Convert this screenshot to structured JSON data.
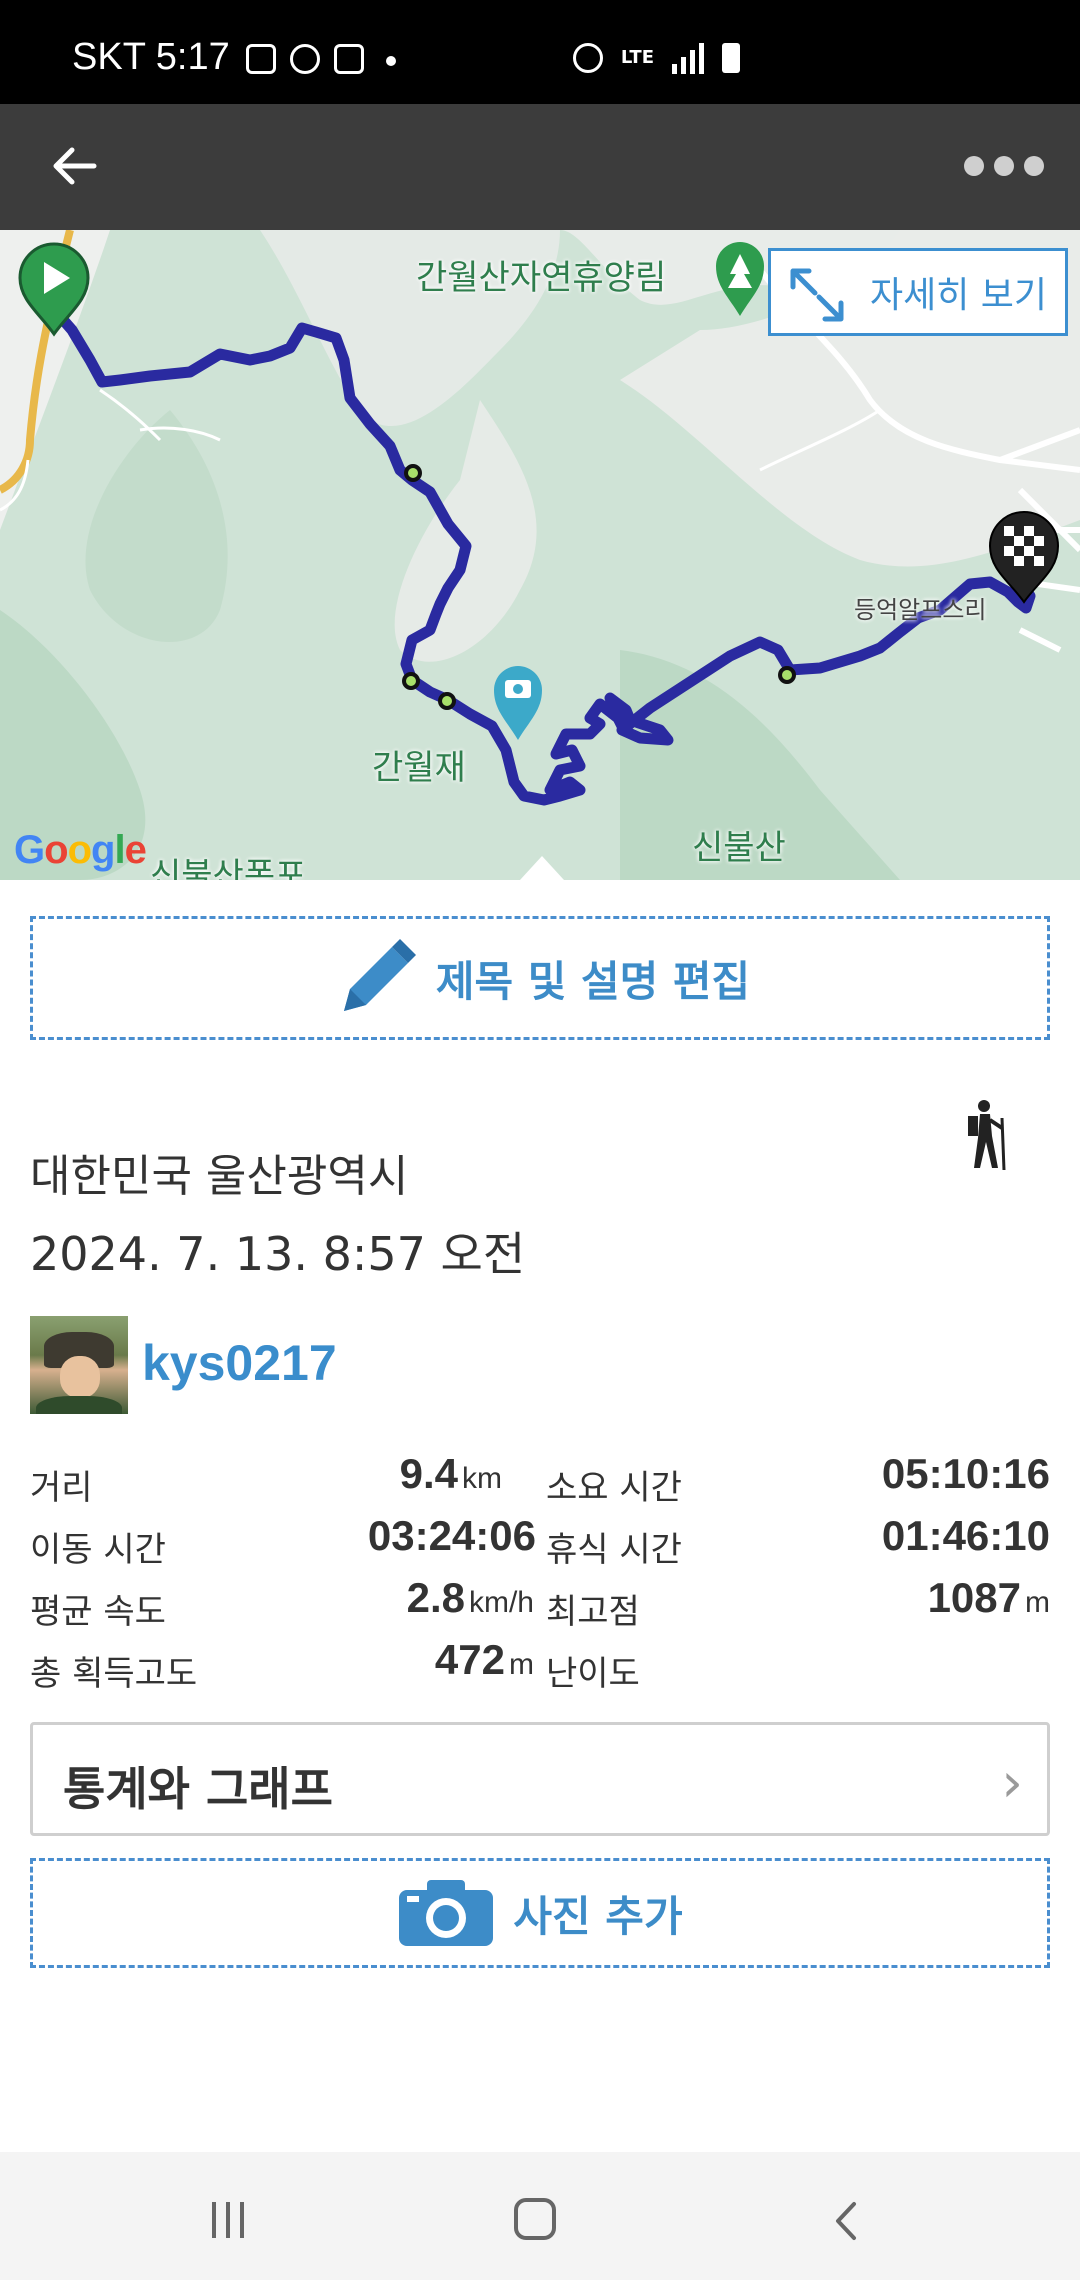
{
  "status_bar": {
    "carrier_time": "SKT 5:17",
    "network": "LTE"
  },
  "app_bar": {
    "back_icon": "arrow-left-icon",
    "more_icon": "more-dots-icon"
  },
  "map": {
    "expand_label": "자세히 보기",
    "labels": {
      "forest": "간월산자연휴양림",
      "pass": "간월재",
      "village": "등억알프스리",
      "mountain": "신불산",
      "bottom_left": "신불산폭포"
    },
    "attribution": "Google"
  },
  "edit_button": {
    "label": "제목 및 설명 편집"
  },
  "activity": {
    "location": "대한민국 울산광역시",
    "datetime": "2024. 7. 13. 8:57 오전",
    "type_icon": "hiking-icon"
  },
  "user": {
    "name": "kys0217"
  },
  "stats": {
    "distance": {
      "label": "거리",
      "value": "9.4",
      "unit": "km"
    },
    "total_time": {
      "label": "소요 시간",
      "value": "05:10:16"
    },
    "moving_time": {
      "label": "이동 시간",
      "value": "03:24:06"
    },
    "rest_time": {
      "label": "휴식 시간",
      "value": "01:46:10"
    },
    "avg_speed": {
      "label": "평균 속도",
      "value": "2.8",
      "unit": "km/h"
    },
    "max_elevation": {
      "label": "최고점",
      "value": "1087",
      "unit": "m"
    },
    "elevation_gain": {
      "label": "총 획득고도",
      "value": "472",
      "unit": "m"
    },
    "difficulty": {
      "label": "난이도"
    }
  },
  "graph_button": {
    "label": "통계와 그래프",
    "chevron": "›"
  },
  "photo_button": {
    "label": "사진 추가"
  },
  "colors": {
    "accent": "#3d8cc8",
    "track": "#2a2aa0",
    "appbar": "#3c3c3c"
  }
}
